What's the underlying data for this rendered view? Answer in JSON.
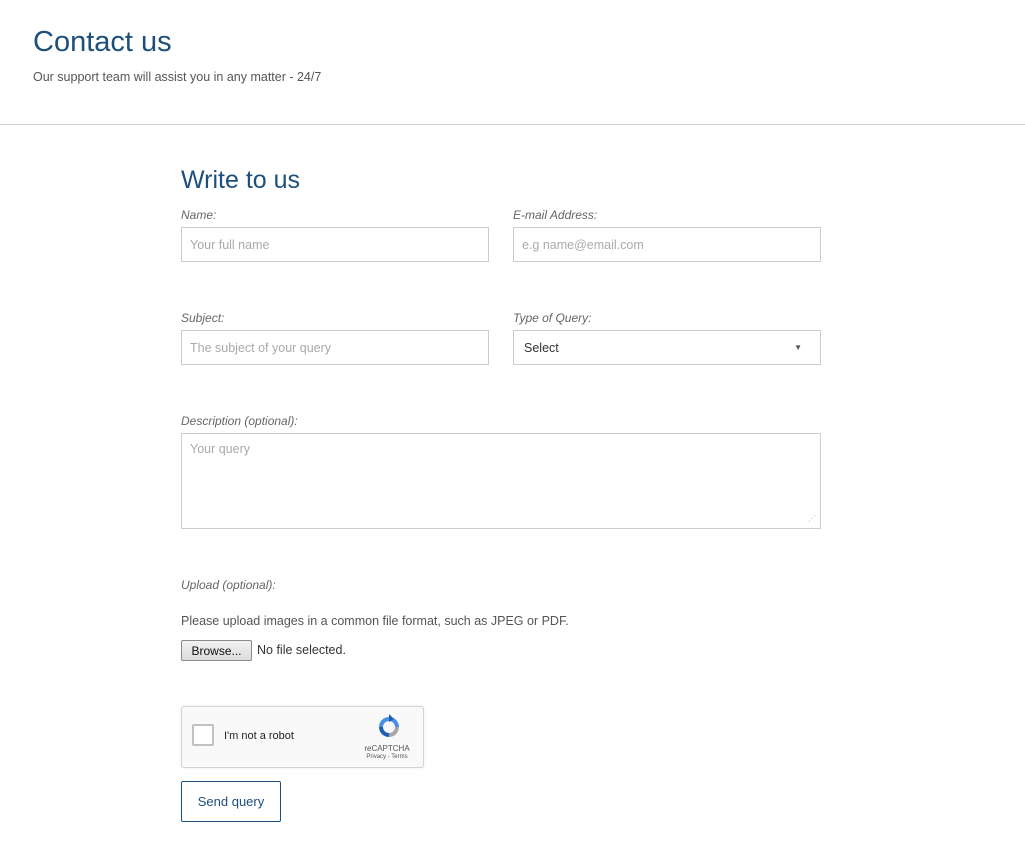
{
  "header": {
    "title": "Contact us",
    "subtitle": "Our support team will assist you in any matter - 24/7"
  },
  "form": {
    "title": "Write to us",
    "name": {
      "label": "Name:",
      "placeholder": "Your full name",
      "value": ""
    },
    "email": {
      "label": "E-mail Address:",
      "placeholder": "e.g name@email.com",
      "value": ""
    },
    "subject": {
      "label": "Subject:",
      "placeholder": "The subject of your query",
      "value": ""
    },
    "query_type": {
      "label": "Type of Query:",
      "selected": "Select"
    },
    "description": {
      "label": "Description (optional):",
      "placeholder": "Your query",
      "value": ""
    },
    "upload": {
      "label": "Upload (optional):",
      "hint": "Please upload images in a common file format, such as JPEG or PDF.",
      "browse_label": "Browse...",
      "status": "No file selected."
    },
    "captcha": {
      "label": "I'm not a robot",
      "brand": "reCAPTCHA",
      "links": "Privacy - Terms",
      "checked": false
    },
    "submit_label": "Send query"
  },
  "colors": {
    "accent": "#1d4f7c",
    "border": "#cccccc",
    "divider": "#cfcfcf"
  },
  "icons": {
    "select_caret": "caret-down-icon",
    "captcha_logo": "recaptcha-logo-icon",
    "textarea_grip": "resize-grip-icon"
  }
}
